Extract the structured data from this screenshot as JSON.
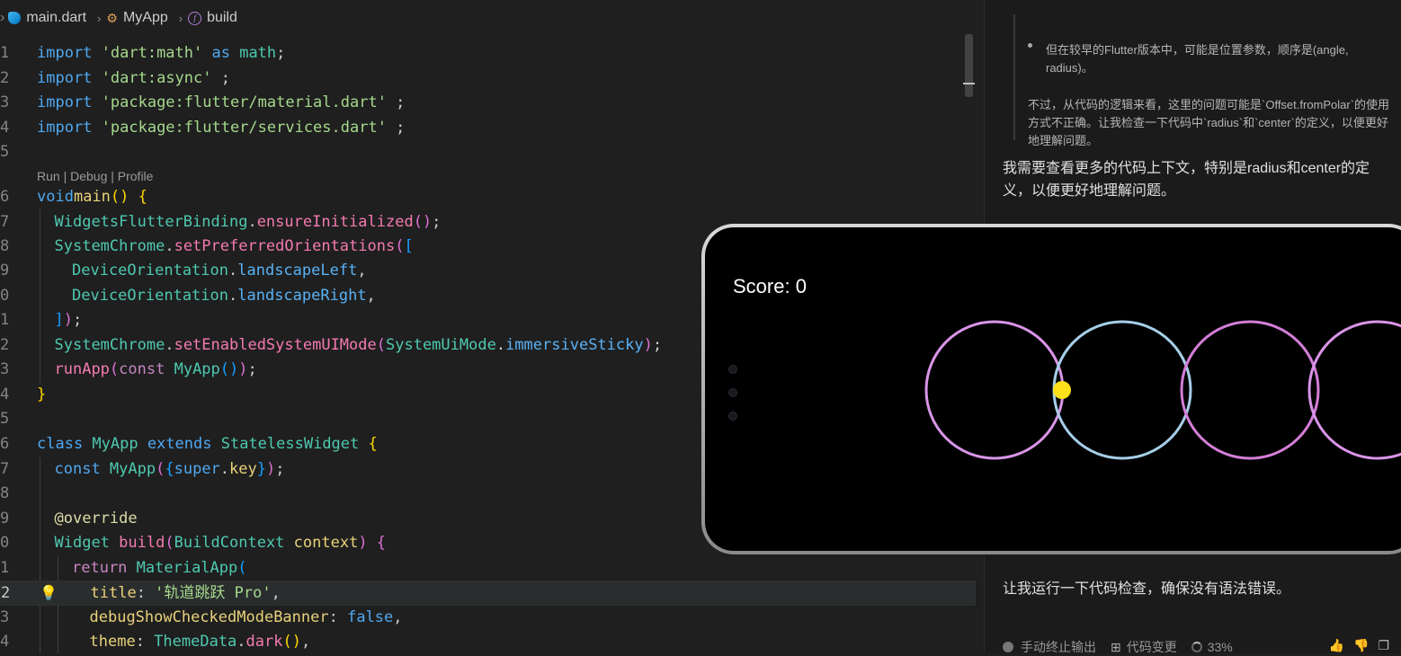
{
  "breadcrumb": {
    "file": "main.dart",
    "class": "MyApp",
    "method": "build"
  },
  "codelens": "Run | Debug | Profile",
  "line_numbers": [
    "1",
    "2",
    "3",
    "4",
    "5",
    "6",
    "7",
    "8",
    "9",
    "0",
    "1",
    "2",
    "3",
    "4",
    "5",
    "6",
    "7",
    "8",
    "9",
    "0",
    "1",
    "2",
    "3",
    "4"
  ],
  "code": {
    "l1": [
      "import",
      "'dart:math'",
      "as",
      "math",
      ";"
    ],
    "l2": [
      "import",
      "'dart:async'",
      ";"
    ],
    "l3": [
      "import",
      "'package:flutter/material.dart'",
      ";"
    ],
    "l4": [
      "import",
      "'package:flutter/services.dart'",
      ";"
    ],
    "l6": [
      "void",
      "main",
      "()",
      " {"
    ],
    "l7": [
      "WidgetsFlutterBinding",
      ".",
      "ensureInitialized",
      "()",
      ";"
    ],
    "l8": [
      "SystemChrome",
      ".",
      "setPreferredOrientations",
      "(",
      "["
    ],
    "l9": [
      "DeviceOrientation",
      ".",
      "landscapeLeft",
      ","
    ],
    "l10": [
      "DeviceOrientation",
      ".",
      "landscapeRight",
      ","
    ],
    "l11": [
      "]",
      ")",
      ";"
    ],
    "l12": [
      "SystemChrome",
      ".",
      "setEnabledSystemUIMode",
      "(",
      "SystemUiMode",
      ".",
      "immersiveSticky",
      ")",
      ";"
    ],
    "l13": [
      "runApp",
      "(",
      "const",
      " MyApp",
      "()",
      ")",
      ";"
    ],
    "l14": [
      "}"
    ],
    "l16": [
      "class",
      " MyApp ",
      "extends",
      " StatelessWidget ",
      "{"
    ],
    "l17": [
      "const",
      " MyApp",
      "(",
      "{",
      "super",
      ".",
      "key",
      "}",
      ")",
      ";"
    ],
    "l19": [
      "@override"
    ],
    "l20": [
      "Widget",
      " build",
      "(",
      "BuildContext",
      " context",
      ")",
      " {"
    ],
    "l21": [
      "return",
      " MaterialApp",
      "("
    ],
    "l22": [
      "title",
      ": ",
      "'轨道跳跃 Pro'",
      ","
    ],
    "l23": [
      "debugShowCheckedModeBanner",
      ": ",
      "false",
      ","
    ],
    "l24": [
      "theme",
      ": ",
      "ThemeData",
      ".",
      "dark",
      "()",
      ","
    ]
  },
  "chat": {
    "quote_bullet": "但在较早的Flutter版本中，可能是位置参数，顺序是(angle, radius)。",
    "quote_text": "不过，从代码的逻辑来看，这里的问题可能是`Offset.fromPolar`的使用方式不正确。让我检查一下代码中`radius`和`center`的定义，以便更好地理解问题。",
    "msg1": "我需要查看更多的代码上下文，特别是radius和center的定义，以便更好地理解问题。",
    "msg2": "让我运行一下代码检查，确保没有语法错误。",
    "status_stop": "手动终止输出",
    "status_diff": "代码变更",
    "status_progress": "33%"
  },
  "game": {
    "score": "Score: 0",
    "ring_colors": [
      "#d994e8",
      "#a6cfe8",
      "#d47ed8",
      "#d994e8"
    ],
    "ball_color": "#ffe01a"
  }
}
